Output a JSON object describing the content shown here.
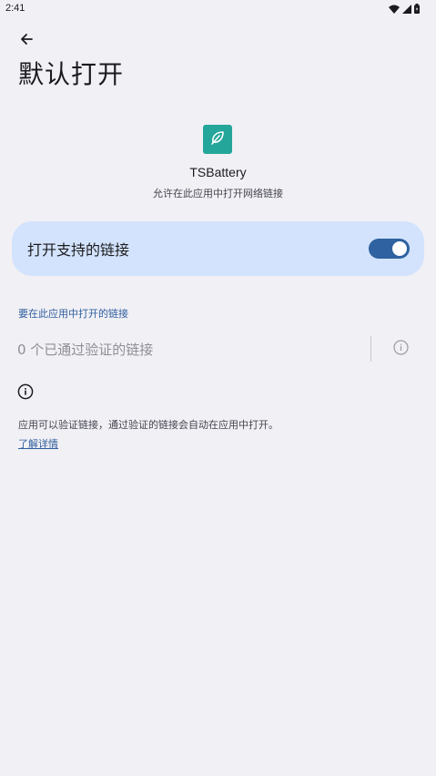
{
  "status_bar": {
    "time": "2:41",
    "icons": [
      "wifi-icon",
      "signal-icon",
      "battery-icon"
    ]
  },
  "header": {
    "back_icon": "arrow-back-icon",
    "title": "默认打开"
  },
  "app": {
    "icon": "leaf-icon",
    "icon_color": "#25a69a",
    "name": "TSBattery",
    "subtitle": "允许在此应用中打开网络链接"
  },
  "toggle": {
    "label": "打开支持的链接",
    "enabled": true,
    "card_color": "#d3e3fd",
    "switch_color": "#2e62a0"
  },
  "links_section": {
    "header": "要在此应用中打开的链接",
    "verified_text": "0 个已通过验证的链接",
    "info_icon": "info-icon"
  },
  "footer": {
    "icon": "info-icon",
    "text": "应用可以验证链接，通过验证的链接会自动在应用中打开。",
    "learn_more": "了解详情"
  }
}
